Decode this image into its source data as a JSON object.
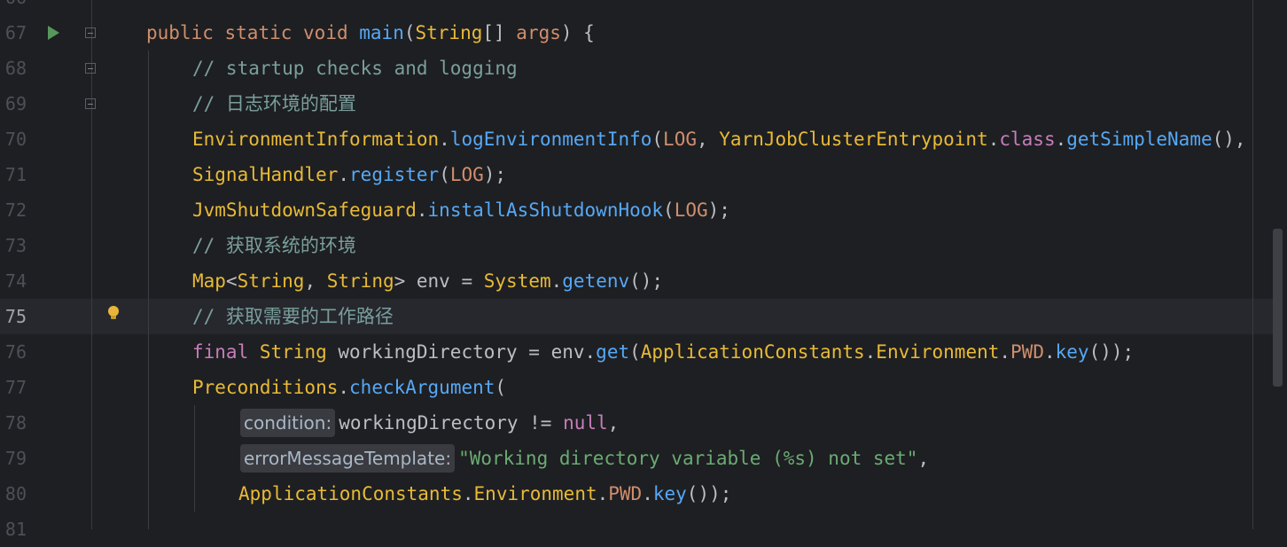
{
  "editor": {
    "line_numbers": [
      "67",
      "68",
      "69",
      "70",
      "71",
      "72",
      "73",
      "74",
      "75",
      "76",
      "77",
      "78",
      "79",
      "80",
      "81"
    ],
    "current_line": "75",
    "icons": {
      "run": "run-gutter-icon",
      "fold": "fold-marker-icon",
      "intention": "lightbulb-icon"
    },
    "colors": {
      "background": "#1e1f22",
      "keyword": "#cf8e6d",
      "function": "#56a8f5",
      "class": "#e8ba36",
      "comment": "#7a9f9d",
      "constant": "#c77dbb",
      "string": "#6aab73"
    },
    "lines": {
      "l67": {
        "kw1": "public",
        "kw2": "static",
        "kw3": "void",
        "fn": "main",
        "p1": "(",
        "cls": "String",
        "p2": "[] ",
        "param": "args",
        "p3": ") {"
      },
      "l68": {
        "comment": "// startup checks and logging"
      },
      "l69": {
        "comment": "// 日志环境的配置"
      },
      "l70": {
        "cls1": "EnvironmentInformation",
        "dot1": ".",
        "fn1": "logEnvironmentInfo",
        "p1": "(",
        "const1": "LOG",
        "p2": ", ",
        "cls2": "YarnJobClusterEntrypoint",
        "dot2": ".",
        "kw": "class",
        "dot3": ".",
        "fn2": "getSimpleName",
        "p3": "(),"
      },
      "l71": {
        "cls": "SignalHandler",
        "dot": ".",
        "fn": "register",
        "p1": "(",
        "const": "LOG",
        "p2": ");"
      },
      "l72": {
        "cls": "JvmShutdownSafeguard",
        "dot": ".",
        "fn": "installAsShutdownHook",
        "p1": "(",
        "const": "LOG",
        "p2": ");"
      },
      "l73": {
        "comment": "// 获取系统的环境"
      },
      "l74": {
        "cls1": "Map",
        "p1": "<",
        "cls2": "String",
        "p2": ", ",
        "cls3": "String",
        "p3": "> env = ",
        "cls4": "System",
        "dot": ".",
        "fn": "getenv",
        "p4": "();"
      },
      "l75": {
        "comment": "// 获取需要的工作路径"
      },
      "l76": {
        "kw": "final",
        "cls1": "String",
        "p1": " workingDirectory = env.",
        "fn1": "get",
        "p2": "(",
        "cls2": "ApplicationConstants",
        "dot1": ".",
        "cls3": "Environment",
        "dot2": ".",
        "const": "PWD",
        "dot3": ".",
        "fn2": "key",
        "p3": "());"
      },
      "l77": {
        "cls": "Preconditions",
        "dot": ".",
        "fn": "checkArgument",
        "p1": "("
      },
      "l78": {
        "hint": "condition:",
        "p1": "workingDirectory != ",
        "kw": "null",
        "p2": ","
      },
      "l79": {
        "hint": "errorMessageTemplate:",
        "str": "\"Working directory variable (%s) not set\"",
        "p1": ","
      },
      "l80": {
        "cls1": "ApplicationConstants",
        "dot1": ".",
        "cls2": "Environment",
        "dot2": ".",
        "const": "PWD",
        "dot3": ".",
        "fn": "key",
        "p1": "());"
      }
    }
  }
}
